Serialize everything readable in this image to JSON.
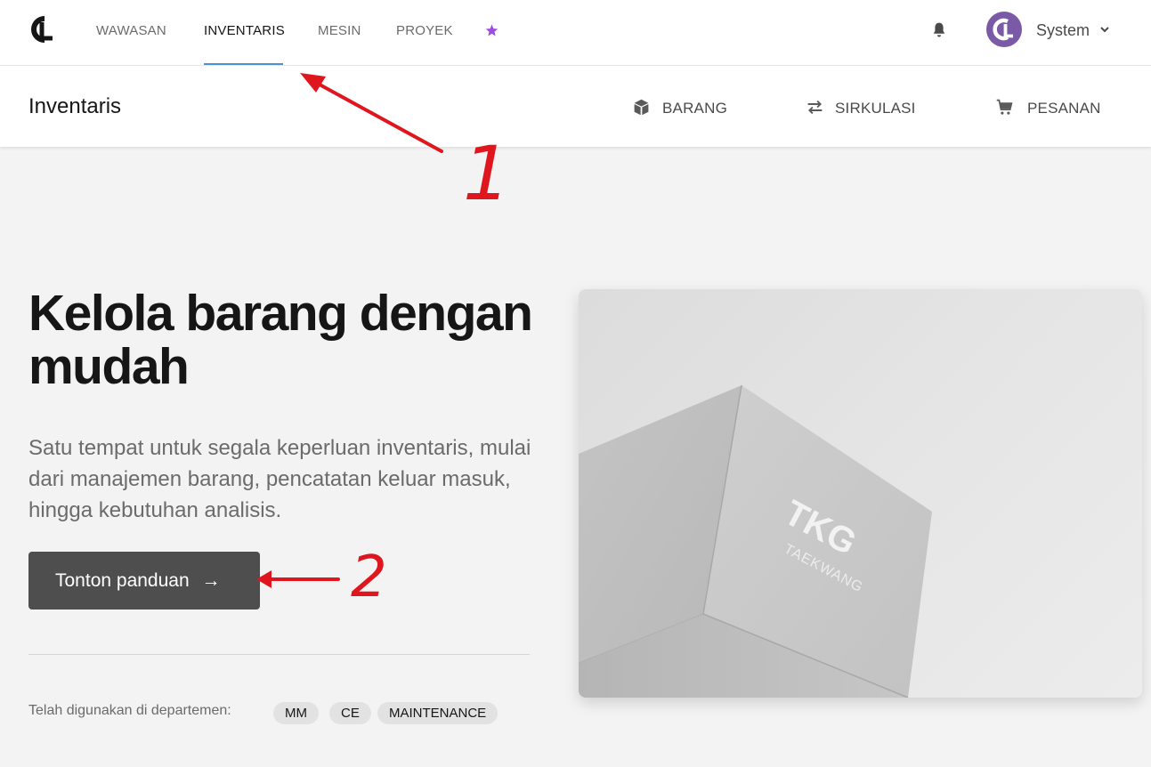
{
  "topnav": {
    "items": [
      {
        "label": "WAWASAN"
      },
      {
        "label": "INVENTARIS"
      },
      {
        "label": "MESIN"
      },
      {
        "label": "PROYEK"
      }
    ],
    "user_name": "System"
  },
  "subheader": {
    "title": "Inventaris",
    "tabs": [
      {
        "label": "BARANG",
        "icon": "cube-icon"
      },
      {
        "label": "SIRKULASI",
        "icon": "swap-arrows-icon"
      },
      {
        "label": "PESANAN",
        "icon": "cart-icon"
      }
    ]
  },
  "hero": {
    "title": "Kelola barang dengan mudah",
    "description": "Satu tempat untuk segala keperluan inventaris, mulai dari manajemen barang, pencatatan keluar masuk, hingga kebutuhan analisis.",
    "cta_label": "Tonton panduan",
    "cta_arrow": "→",
    "departments_label": "Telah digunakan di departemen:",
    "departments": [
      "MM",
      "CE",
      "MAINTENANCE"
    ],
    "image_brand": "TKG",
    "image_subbrand": "TAEKWANG"
  },
  "annotations": {
    "label_1": "1",
    "label_2": "2",
    "color": "#e0161e"
  },
  "colors": {
    "accent_underline": "#4a90d9",
    "avatar": "#7a5aa6",
    "cta_bg": "#4e4e4e",
    "star": "#9b4de0"
  }
}
